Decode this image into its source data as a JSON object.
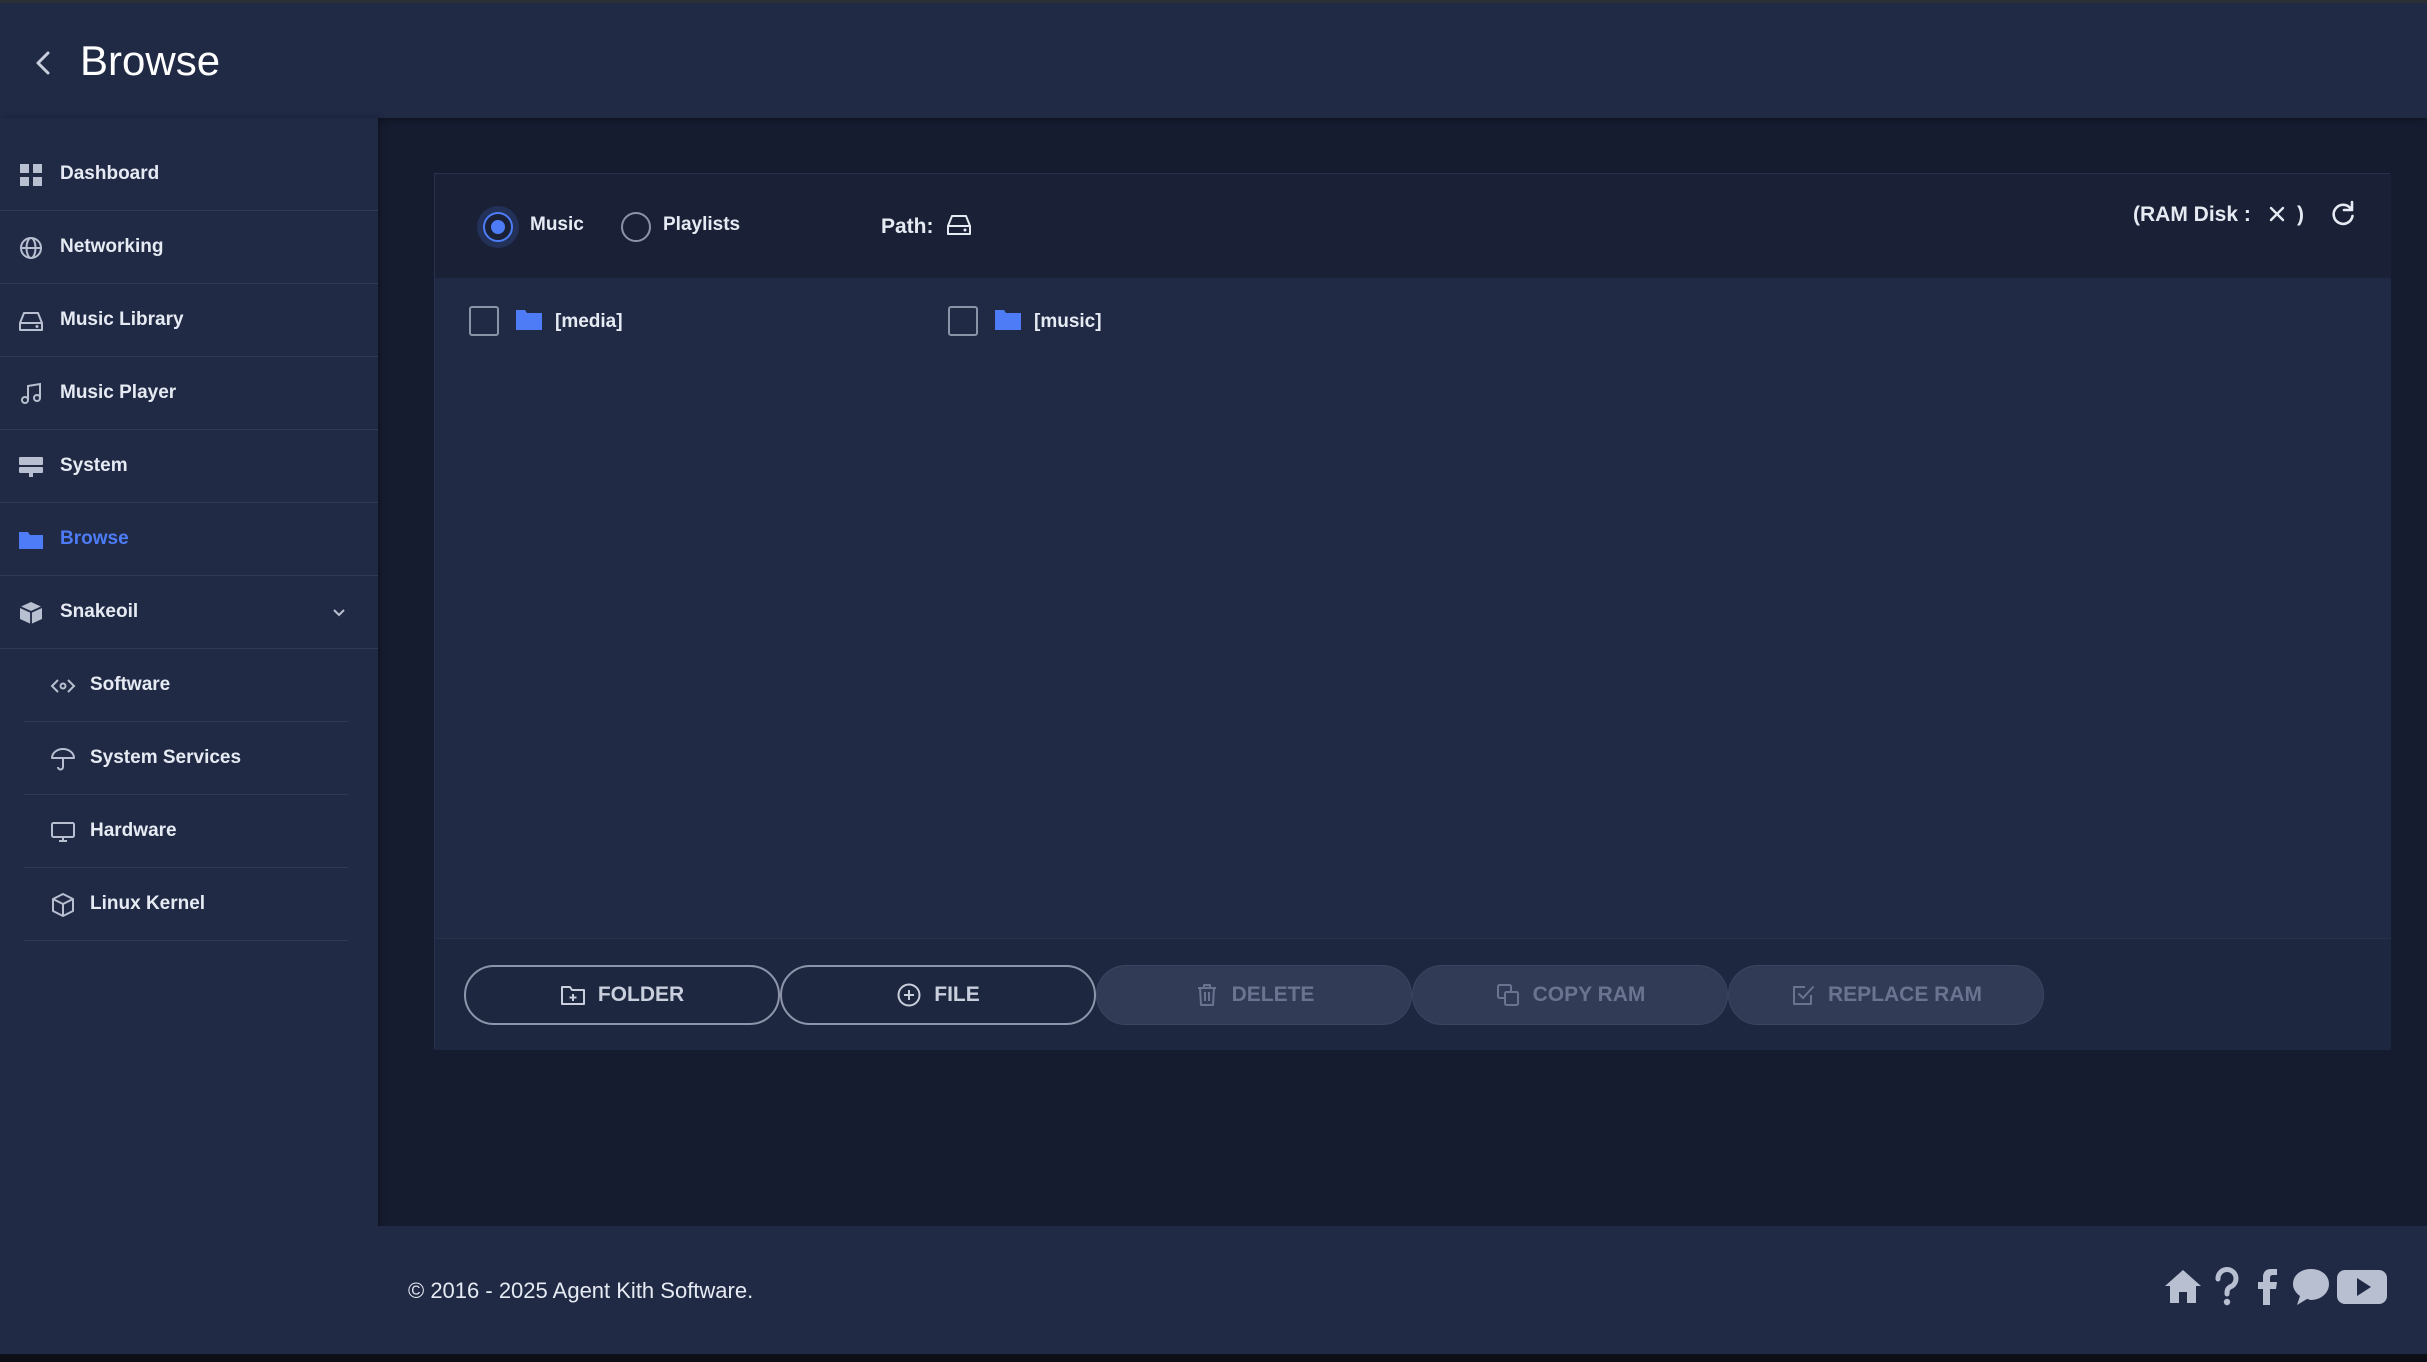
{
  "header": {
    "title": "Browse"
  },
  "sidebar": {
    "items": [
      {
        "label": "Dashboard",
        "icon": "grid-icon"
      },
      {
        "label": "Networking",
        "icon": "globe-icon"
      },
      {
        "label": "Music Library",
        "icon": "hard-drive-icon"
      },
      {
        "label": "Music Player",
        "icon": "music-note-icon"
      },
      {
        "label": "System",
        "icon": "server-icon"
      },
      {
        "label": "Browse",
        "icon": "folder-icon",
        "active": true
      },
      {
        "label": "Snakeoil",
        "icon": "box-icon",
        "expanded": true
      }
    ],
    "sub_items": [
      {
        "label": "Software",
        "icon": "code-icon"
      },
      {
        "label": "System Services",
        "icon": "umbrella-icon"
      },
      {
        "label": "Hardware",
        "icon": "monitor-icon"
      },
      {
        "label": "Linux Kernel",
        "icon": "cube-icon"
      }
    ]
  },
  "browser": {
    "source_options": [
      {
        "label": "Music",
        "selected": true
      },
      {
        "label": "Playlists",
        "selected": false
      }
    ],
    "path_label": "Path:",
    "ram_disk_label": "(RAM Disk :",
    "ram_disk_close": ")",
    "entries": [
      {
        "name": "[media]",
        "checked": false
      },
      {
        "name": "[music]",
        "checked": false
      }
    ],
    "actions": [
      {
        "label": "FOLDER",
        "icon": "folder-plus-icon",
        "enabled": true
      },
      {
        "label": "FILE",
        "icon": "plus-circle-icon",
        "enabled": true
      },
      {
        "label": "DELETE",
        "icon": "trash-icon",
        "enabled": false
      },
      {
        "label": "COPY RAM",
        "icon": "copy-icon",
        "enabled": false
      },
      {
        "label": "REPLACE RAM",
        "icon": "checkbox-icon",
        "enabled": false
      }
    ]
  },
  "footer": {
    "copyright": "© 2016 - 2025 Agent Kith Software.",
    "links": [
      "home-icon",
      "help-icon",
      "facebook-icon",
      "chat-icon",
      "youtube-icon"
    ]
  },
  "colors": {
    "accent": "#4d7cf6",
    "panel_bg": "#202a45",
    "page_bg": "#161c30"
  }
}
